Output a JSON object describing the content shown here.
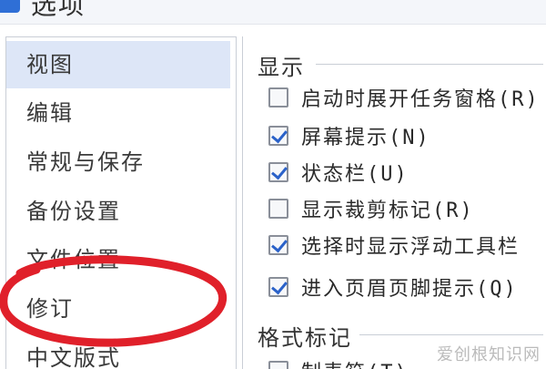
{
  "window": {
    "title": "选项"
  },
  "sidebar": {
    "items": [
      {
        "label": "视图",
        "selected": true
      },
      {
        "label": "编辑"
      },
      {
        "label": "常规与保存"
      },
      {
        "label": "备份设置"
      },
      {
        "label": "文件位置"
      },
      {
        "label": "修订"
      },
      {
        "label": "中文版式"
      }
    ]
  },
  "display_group": {
    "title": "显示",
    "options": [
      {
        "label": "启动时展开任务窗格(R)",
        "checked": false
      },
      {
        "label": "屏幕提示(N)",
        "checked": true
      },
      {
        "label": "状态栏(U)",
        "checked": true
      },
      {
        "label": "显示裁剪标记(R)",
        "checked": false
      },
      {
        "label": "选择时显示浮动工具栏",
        "checked": true
      },
      {
        "label": "进入页眉页脚提示(Q)",
        "checked": true
      }
    ]
  },
  "format_group": {
    "title": "格式标记",
    "options": [
      {
        "label": "制表符(T)",
        "checked": false
      }
    ]
  },
  "annotation": {
    "color": "#e0202a",
    "target": "sidebar-item-revision"
  },
  "watermark": {
    "text": "爱创根知识网"
  },
  "colors": {
    "selected_bg": "#dde6f7",
    "check_color": "#2b62c9"
  }
}
